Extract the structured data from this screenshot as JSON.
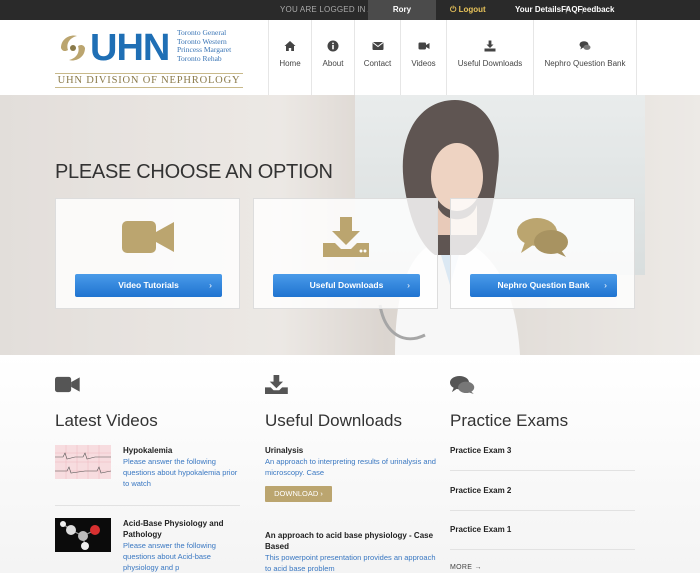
{
  "topbar": {
    "logged_in_as": "YOU ARE LOGGED IN AS",
    "user": "Rory",
    "logout": "Logout",
    "your_details": "Your Details",
    "faq": "FAQ",
    "feedback": "Feedback"
  },
  "logo": {
    "wordmark": "UHN",
    "hospitals": [
      "Toronto General",
      "Toronto Western",
      "Princess Margaret",
      "Toronto Rehab"
    ],
    "division": "UHN DIVISION OF NEPHROLOGY"
  },
  "nav": [
    {
      "label": "Home",
      "icon": "home-icon"
    },
    {
      "label": "About",
      "icon": "info-icon"
    },
    {
      "label": "Contact",
      "icon": "envelope-icon"
    },
    {
      "label": "Videos",
      "icon": "video-camera-icon"
    },
    {
      "label": "Useful Downloads",
      "icon": "download-icon"
    },
    {
      "label": "Nephro Question Bank",
      "icon": "comments-icon"
    }
  ],
  "hero": {
    "title": "PLEASE CHOOSE AN OPTION",
    "options": [
      {
        "label": "Video Tutorials",
        "icon": "video-camera-icon"
      },
      {
        "label": "Useful Downloads",
        "icon": "download-icon"
      },
      {
        "label": "Nephro Question Bank",
        "icon": "comments-icon"
      }
    ]
  },
  "latest_videos": {
    "title": "Latest Videos",
    "items": [
      {
        "title": "Hypokalemia",
        "desc": "Please answer the following questions about hypokalemia prior to watch"
      },
      {
        "title": "Acid-Base Physiology and Pathology",
        "desc": "Please answer the following questions about Acid-base physiology and p"
      }
    ]
  },
  "useful_downloads": {
    "title": "Useful Downloads",
    "items": [
      {
        "title": "Urinalysis",
        "desc": "An approach to interpreting results of urinalysis and microscopy. Case",
        "button": "DOWNLOAD"
      },
      {
        "title": "An approach to acid base physiology - Case Based",
        "desc": "This powerpoint presentation provides an approach to acid base problem"
      }
    ]
  },
  "practice_exams": {
    "title": "Practice Exams",
    "items": [
      "Practice Exam 3",
      "Practice Exam 2",
      "Practice Exam 1"
    ],
    "more": "MORE"
  },
  "colors": {
    "accent_gold": "#bba56f",
    "button_blue": "#2a7fdc",
    "brand_blue": "#1f6fb5",
    "link_blue": "#3a78c2"
  }
}
